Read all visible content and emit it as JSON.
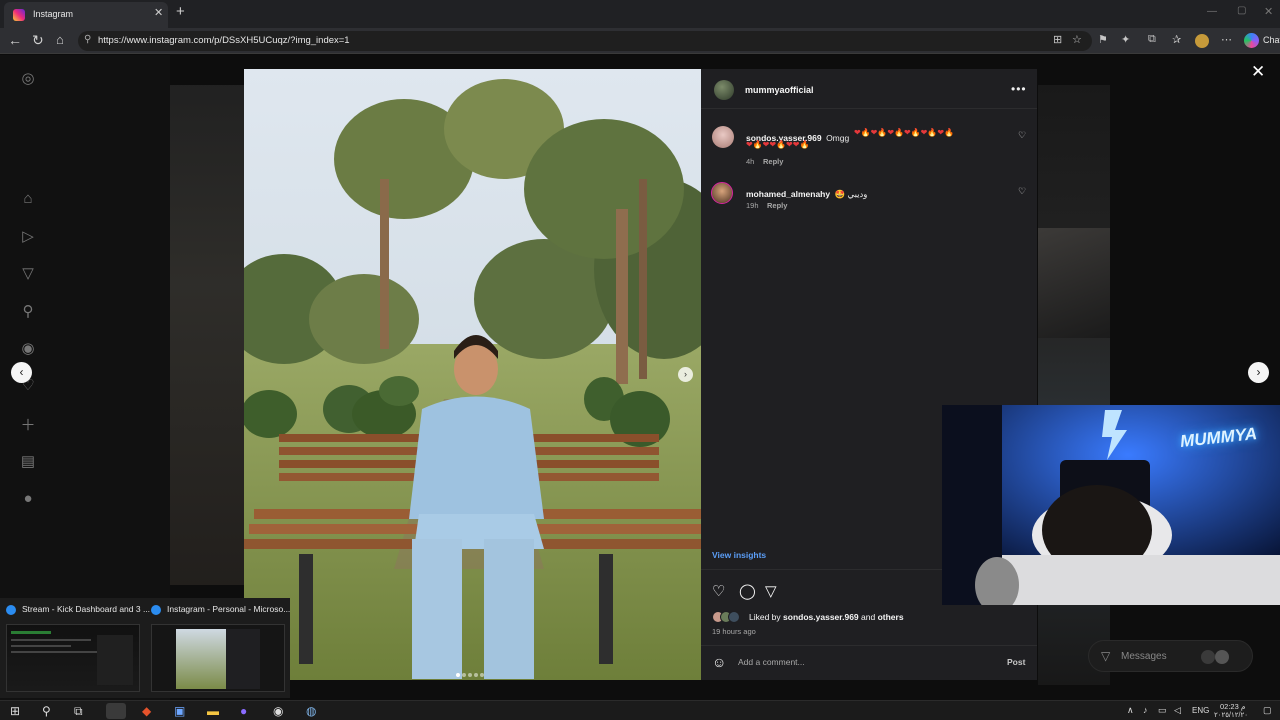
{
  "browser": {
    "tab_title": "Instagram",
    "new_tab_symbol": "+",
    "close_symbol": "✕",
    "url": "https://www.instagram.com/p/DSsXH5UCuqz/?img_index=1",
    "copilot_label": "Chat"
  },
  "post": {
    "author": "mummyaofficial",
    "more_symbol": "•••",
    "comments": [
      {
        "user": "sondos.yasser.969",
        "text": "Omgg",
        "emojis_line1": "❤🔥❤🔥❤🔥❤🔥❤🔥❤🔥",
        "emojis_line2": "❤🔥❤❤🔥❤❤🔥",
        "time": "4h",
        "reply": "Reply"
      },
      {
        "user": "mohamed_almenahy",
        "text": "🤩 وديبي",
        "time": "19h",
        "reply": "Reply"
      }
    ],
    "view_insights": "View insights",
    "liked_by_prefix": "Liked by",
    "liked_by_user": "sondos.yasser.969",
    "liked_by_and": "and",
    "liked_by_suffix": "others",
    "time_ago": "19 hours ago",
    "comment_placeholder": "Add a comment...",
    "post_button": "Post"
  },
  "overlay": {
    "webcam_neon_text": "MUMMYA",
    "messages_label": "Messages"
  },
  "taskbar": {
    "preview1_title": "Stream - Kick Dashboard and 3 ...",
    "preview2_title": "Instagram - Personal - Microso...",
    "lang": "ENG",
    "time": "02:23 م",
    "date": "٢٠٢٥/١٢/٢٠"
  },
  "colors": {
    "panel_bg": "#1f1f22",
    "link_blue": "#5b9ef7",
    "heart_red": "#e5383b"
  },
  "icons": {
    "left_nav": [
      "instagram-icon",
      "home-icon",
      "reels-icon",
      "send-icon",
      "search-icon",
      "explore-icon",
      "heart-icon",
      "create-icon",
      "insights-icon",
      "profile-icon"
    ]
  }
}
